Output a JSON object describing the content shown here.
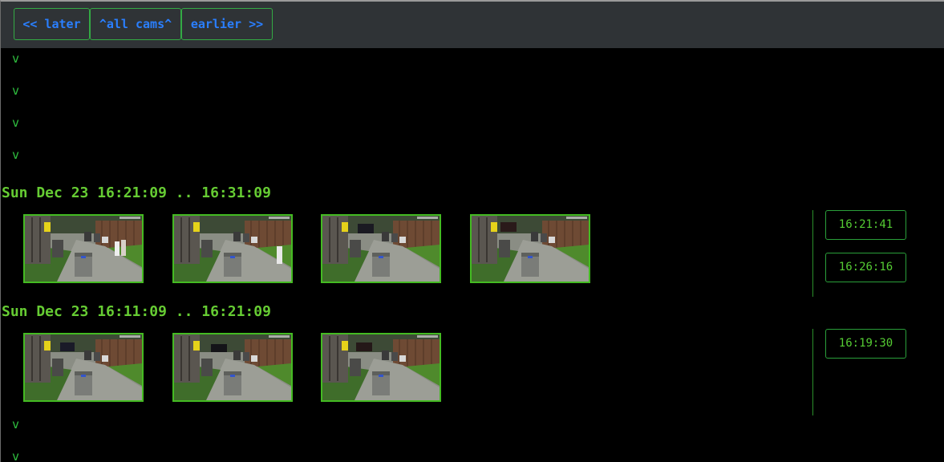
{
  "nav": {
    "later_label": "<< later",
    "all_cams_label": "^all cams^",
    "earlier_label": "earlier >>"
  },
  "expander_glyph": "v",
  "groups": [
    {
      "range": "Sun Dec 23 16:21:09 .. 16:31:09",
      "thumbnail_count": 4,
      "timestamps": [
        "16:21:41",
        "16:26:16"
      ]
    },
    {
      "range": "Sun Dec 23 16:11:09 .. 16:21:09",
      "thumbnail_count": 3,
      "timestamps": [
        "16:19:30"
      ]
    }
  ],
  "colors": {
    "nav_background": "#2f3336",
    "nav_text": "#2a7fff",
    "accent_green": "#66cc33",
    "border_green": "#33aa44",
    "page_background": "#000000"
  }
}
